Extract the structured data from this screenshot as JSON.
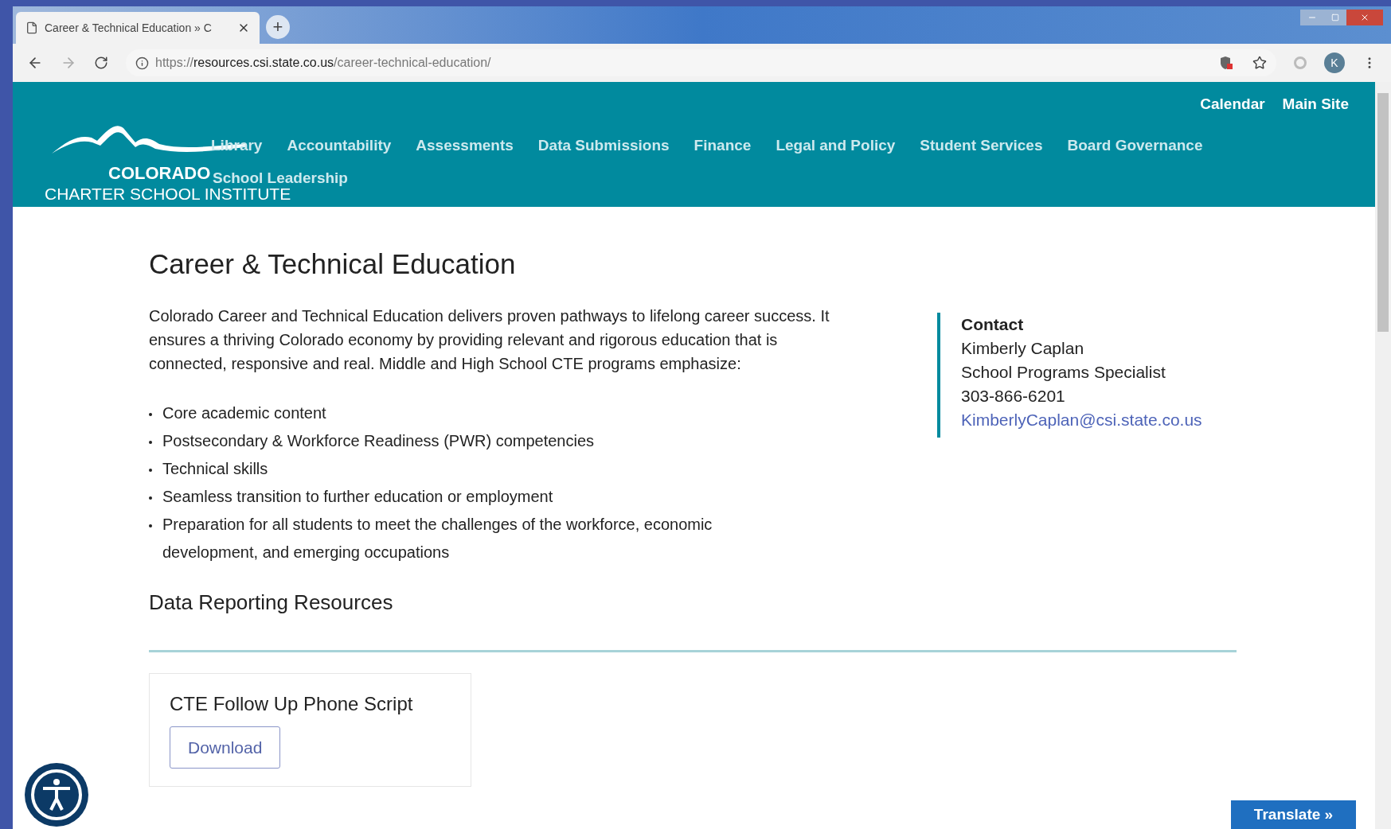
{
  "browser": {
    "tab_title": "Career & Technical Education » C",
    "new_tab": "+",
    "url": "https://**resources.csi.state.co.us**/career-technical-education/",
    "avatar": "K"
  },
  "header": {
    "logo": {
      "name": "COLORADO",
      "subtitle": "CHARTER SCHOOL INSTITUTE"
    },
    "top_links": [
      "Calendar",
      "Main Site"
    ],
    "nav": [
      {
        "label": "Library"
      },
      {
        "label": "Accountability"
      },
      {
        "label": "Assessments"
      },
      {
        "label": "Data Submissions"
      },
      {
        "label": "Finance"
      },
      {
        "label": "Legal and Policy"
      },
      {
        "label": "Student Services"
      },
      {
        "label": "Board Governance"
      }
    ],
    "nav_row2": [
      {
        "label": "School Leadership"
      }
    ]
  },
  "page": {
    "title": "Career & Technical Education",
    "intro": "Colorado Career and Technical Education delivers proven pathways to lifelong career success. It ensures a thriving Colorado economy by providing relevant and rigorous education that is connected, responsive and real. Middle and High School CTE programs emphasize:",
    "bullets": [
      "Core academic content",
      "Postsecondary & Workforce Readiness (PWR) competencies",
      "Technical skills",
      "Seamless transition to further education or employment",
      "Preparation for all students to meet the challenges of the workforce, economic development, and emerging occupations"
    ],
    "section_title": "Data Reporting Resources",
    "resources": [
      {
        "title": "CTE Follow Up Phone Script",
        "button": "Download"
      }
    ],
    "contact": {
      "heading": "Contact",
      "name": "Kimberly Caplan",
      "role": "School Programs Specialist",
      "phone": "303-866-6201",
      "email": "KimberlyCaplan@csi.state.co.us"
    }
  },
  "translate_button": "Translate »"
}
